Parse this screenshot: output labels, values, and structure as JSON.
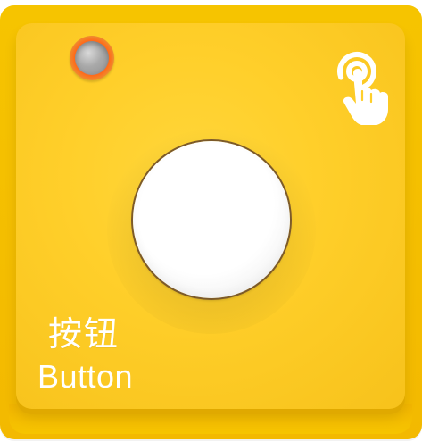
{
  "module": {
    "label_cn": "按钮",
    "label_en": "Button",
    "colors": {
      "body": "#ffcf2a",
      "body_edge": "#f3b900",
      "button_face": "#ffffff",
      "button_rim": "#7c5a2a",
      "led_ring": "#ff6a1a",
      "led_lens": "#a9a9a9",
      "label_text": "#ffffff"
    },
    "icons": {
      "led": "led-indicator-icon",
      "tap": "tap-finger-icon"
    }
  }
}
